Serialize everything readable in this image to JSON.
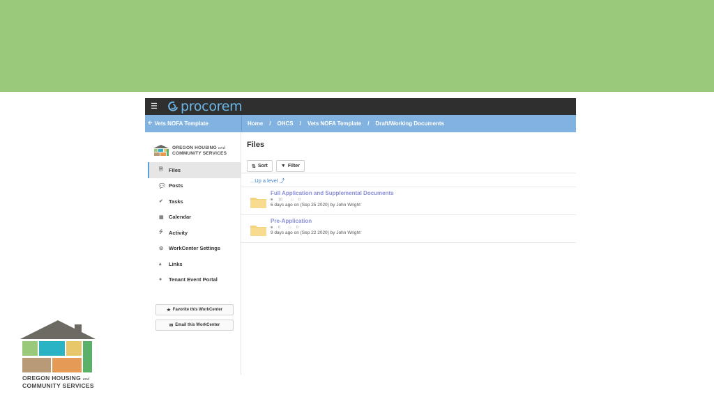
{
  "app": {
    "brand": "procorem",
    "back_link": "Vets NOFA Template"
  },
  "breadcrumb": [
    "Home",
    "OHCS",
    "Vets NOFA Template",
    "Draft/Working Documents"
  ],
  "sidebar": {
    "org_name_line1": "OREGON HOUSING",
    "org_name_and": "and",
    "org_name_line2": "COMMUNITY SERVICES",
    "items": [
      {
        "label": "Files",
        "icon": "file-icon",
        "active": true
      },
      {
        "label": "Posts",
        "icon": "comments-icon"
      },
      {
        "label": "Tasks",
        "icon": "check-icon"
      },
      {
        "label": "Calendar",
        "icon": "calendar-icon"
      },
      {
        "label": "Activity",
        "icon": "bolt-icon"
      },
      {
        "label": "WorkCenter Settings",
        "icon": "gear-icon"
      },
      {
        "label": "Links",
        "icon": "sitemap-icon"
      },
      {
        "label": "Tenant Event Portal",
        "icon": "users-icon"
      }
    ],
    "favorite_button": "Favorite this WorkCenter",
    "email_button": "Email this WorkCenter"
  },
  "main": {
    "title": "Files",
    "sort_label": "Sort",
    "filter_label": "Filter",
    "up_level": "...Up a level",
    "folders": [
      {
        "name": "Full Application and Supplemental Documents",
        "file_count": "10",
        "folder_count": "0",
        "meta": "6 days ago on (Sep 25 2020) by John Wright"
      },
      {
        "name": "Pre-Application",
        "file_count": "6",
        "folder_count": "0",
        "meta": "9 days ago on (Sep 22 2020) by John Wright"
      }
    ]
  },
  "footer_logo": {
    "line1": "OREGON HOUSING",
    "and": "and",
    "line2": "COMMUNITY SERVICES"
  },
  "colors": {
    "top_band": "#9bc97c",
    "topbar": "#2f2f2f",
    "breadcrumb_bar": "#82b3e0",
    "folder_link": "#8a8fd6",
    "brand_blue": "#6cb7e8"
  }
}
